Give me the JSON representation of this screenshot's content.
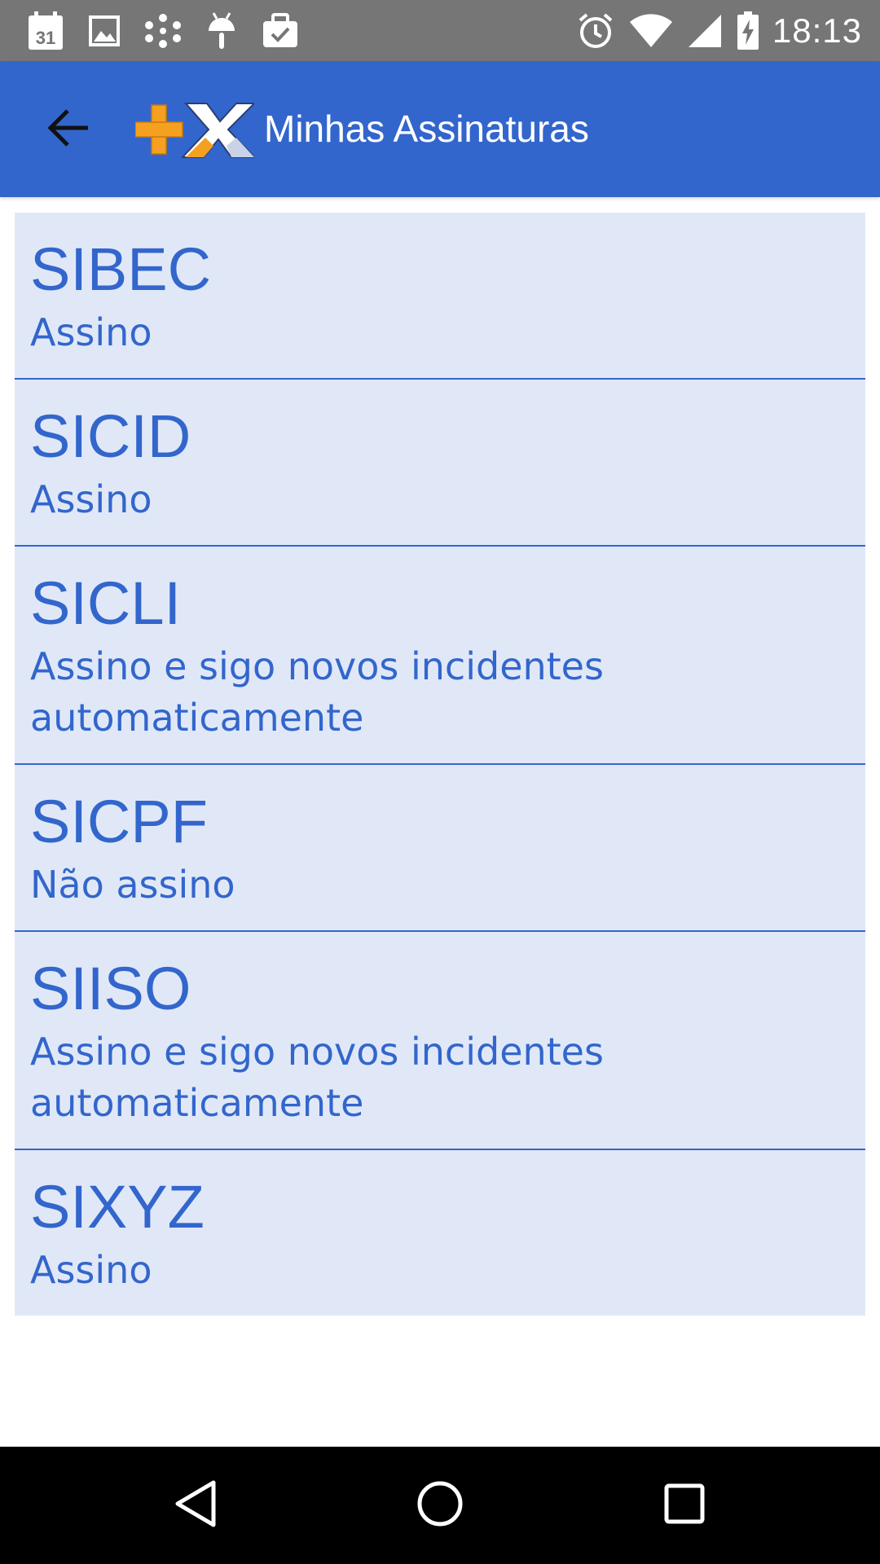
{
  "status_bar": {
    "time": "18:13",
    "calendar_day": "31",
    "left_icons": [
      "calendar-icon",
      "gallery-icon",
      "dots-app-icon",
      "android-icon",
      "briefcase-check-icon"
    ],
    "right_icons": [
      "alarm-icon",
      "wifi-icon",
      "signal-icon",
      "battery-charging-icon"
    ]
  },
  "app_bar": {
    "title": "Minhas Assinaturas",
    "back_icon": "arrow-back-icon",
    "logo_icon": "plus-x-logo-icon"
  },
  "subscriptions": [
    {
      "name": "SIBEC",
      "status": "Assino"
    },
    {
      "name": "SICID",
      "status": "Assino"
    },
    {
      "name": "SICLI",
      "status": "Assino e sigo novos incidentes automaticamente"
    },
    {
      "name": "SICPF",
      "status": "Não assino"
    },
    {
      "name": "SIISO",
      "status": "Assino e sigo novos incidentes automaticamente"
    },
    {
      "name": "SIXYZ",
      "status": "Assino"
    }
  ],
  "nav_bar": {
    "buttons": [
      "back-triangle-icon",
      "home-circle-icon",
      "recents-square-icon"
    ]
  },
  "colors": {
    "primary": "#3366cc",
    "list_background": "#e0e8f8",
    "status_bar": "#767676",
    "logo_orange": "#f5a020"
  }
}
